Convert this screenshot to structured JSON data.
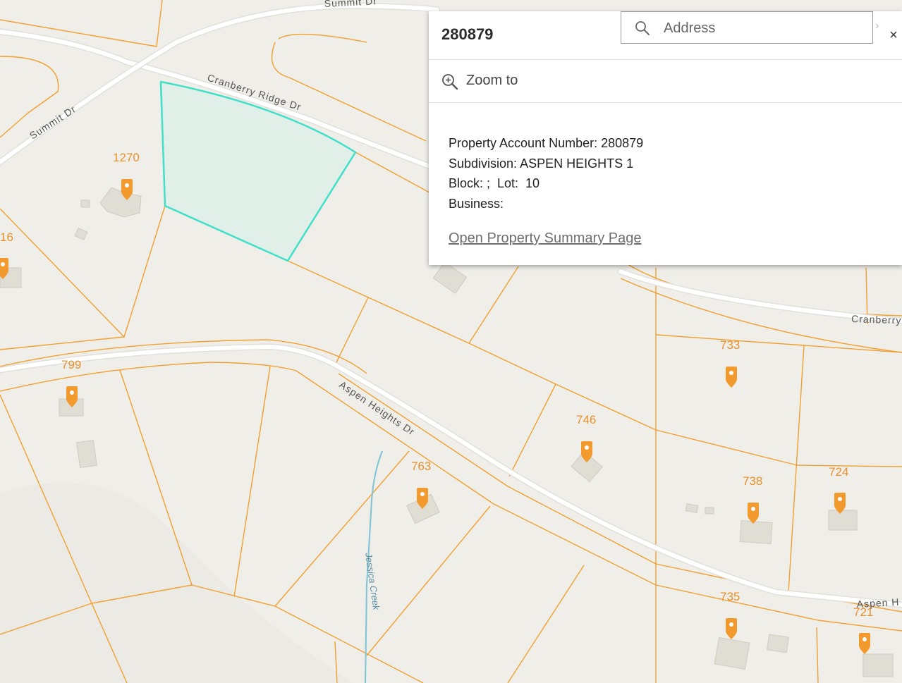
{
  "map": {
    "roads": {
      "summit_top": "Summit Dr",
      "summit_left": "Summit Dr",
      "cranberry_ridge": "Cranberry Ridge Dr",
      "cranberry_right": "Cranberry",
      "aspen_heights": "Aspen Heights Dr",
      "aspen_right": "Aspen H"
    },
    "creek": "Jessica Creek",
    "addresses": [
      "1270",
      "16",
      "799",
      "763",
      "746",
      "733",
      "738",
      "724",
      "735",
      "721"
    ],
    "colors": {
      "parcel_line": "#f0a030",
      "selected_parcel_outline": "#40e0c8",
      "marker": "#f39a2e",
      "background": "#efeee9"
    }
  },
  "popup": {
    "title": "280879",
    "zoom_label": "Zoom to",
    "fields": [
      "Property Account Number: 280879",
      "Subdivision: ASPEN HEIGHTS 1",
      "Block: ;  Lot:  10",
      "Business:"
    ],
    "link": "Open Property Summary Page",
    "close_icon": "×"
  },
  "search": {
    "placeholder": "Address",
    "expand_icon": "›"
  }
}
